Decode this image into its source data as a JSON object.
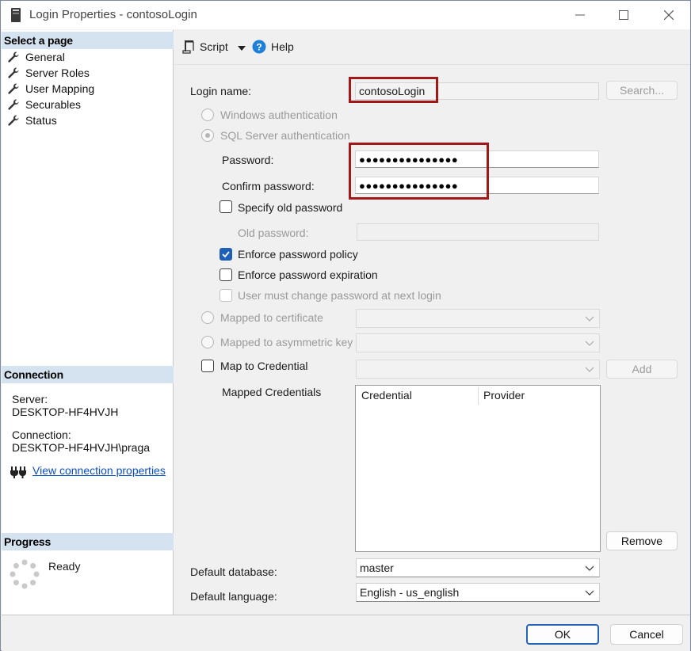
{
  "window": {
    "title": "Login Properties - contosoLogin"
  },
  "left_pane": {
    "select_page_header": "Select a page",
    "pages": [
      "General",
      "Server Roles",
      "User Mapping",
      "Securables",
      "Status"
    ],
    "connection_header": "Connection",
    "server_label": "Server:",
    "server_value": "DESKTOP-HF4HVJH",
    "connection_label": "Connection:",
    "connection_value": "DESKTOP-HF4HVJH\\praga",
    "view_connection_link": "View connection properties",
    "progress_header": "Progress",
    "progress_status": "Ready"
  },
  "toolbar": {
    "script_label": "Script",
    "help_label": "Help"
  },
  "form": {
    "login_name_label": "Login name:",
    "login_name_value": "contosoLogin",
    "search_button": "Search...",
    "windows_auth_label": "Windows authentication",
    "sql_auth_label": "SQL Server authentication",
    "password_label": "Password:",
    "password_value": "●●●●●●●●●●●●●●●",
    "confirm_password_label": "Confirm password:",
    "confirm_password_value": "●●●●●●●●●●●●●●●",
    "specify_old_password_label": "Specify old password",
    "old_password_label": "Old password:",
    "enforce_policy_label": "Enforce password policy",
    "enforce_expiration_label": "Enforce password expiration",
    "must_change_label": "User must change password at next login",
    "mapped_certificate_label": "Mapped to certificate",
    "mapped_asym_key_label": "Mapped to asymmetric key",
    "map_credential_label": "Map to Credential",
    "add_button": "Add",
    "mapped_credentials_label": "Mapped Credentials",
    "grid_columns": [
      "Credential",
      "Provider"
    ],
    "remove_button": "Remove",
    "default_database_label": "Default database:",
    "default_database_value": "master",
    "default_language_label": "Default language:",
    "default_language_value": "English - us_english"
  },
  "footer": {
    "ok_button": "OK",
    "cancel_button": "Cancel"
  },
  "colors": {
    "highlight": "#a01818",
    "section_header": "#d5e3f0",
    "checkbox_checked": "#1f5fb8",
    "link": "#0a4fc4"
  }
}
